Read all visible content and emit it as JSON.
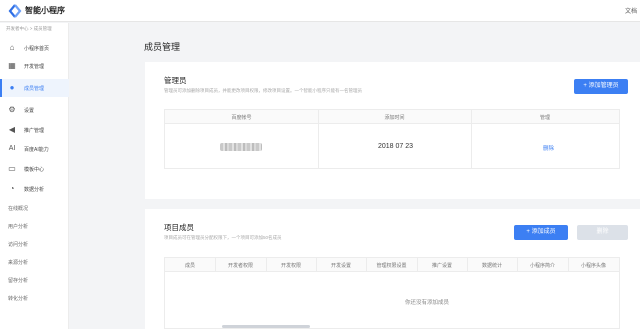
{
  "app": {
    "name": "智能小程序",
    "topright": "文档"
  },
  "breadcrumb": "开发者中心 > 成员管理",
  "sidebar": {
    "items": [
      {
        "label": "小程序首页",
        "icon": "home-icon"
      },
      {
        "label": "开发管理",
        "icon": "code-icon"
      },
      {
        "label": "成员管理",
        "icon": "user-icon",
        "active": true
      },
      {
        "label": "设置",
        "icon": "gear-icon"
      },
      {
        "label": "推广管理",
        "icon": "megaphone-icon"
      },
      {
        "label": "百度AI能力",
        "icon": "ai-icon"
      },
      {
        "label": "模板中心",
        "icon": "template-icon"
      },
      {
        "label": "数据分析",
        "icon": "chart-icon"
      }
    ],
    "sub_items": [
      "在线概况",
      "用户分析",
      "访问分析",
      "来源分析",
      "留存分析",
      "转化分析"
    ]
  },
  "page_title": "成员管理",
  "admin_section": {
    "title": "管理员",
    "desc": "管理员可添加删除项目成员，并能更改项目权限，修改项目设置。一个智能小程序只能有一名管理员",
    "add_button": "+ 添加管理员",
    "columns": [
      "百度帐号",
      "添加时间",
      "管理"
    ],
    "row": {
      "date": "2018 07 23",
      "action": "删除"
    }
  },
  "members_section": {
    "title": "项目成员",
    "desc": "项目成员可在管理员分配权限下，一个项目可添加50名成员",
    "add_button": "+ 添加成员",
    "delete_button": "删除",
    "columns": [
      "成员",
      "开发者权限",
      "开发权限",
      "开发设置",
      "管理权限设置",
      "推广设置",
      "数据统计",
      "小程序简介",
      "小程序头像"
    ],
    "empty_text": "你还没有添加成员"
  },
  "colors": {
    "accent": "#3c7ff3",
    "disabled": "#dce1e8"
  }
}
